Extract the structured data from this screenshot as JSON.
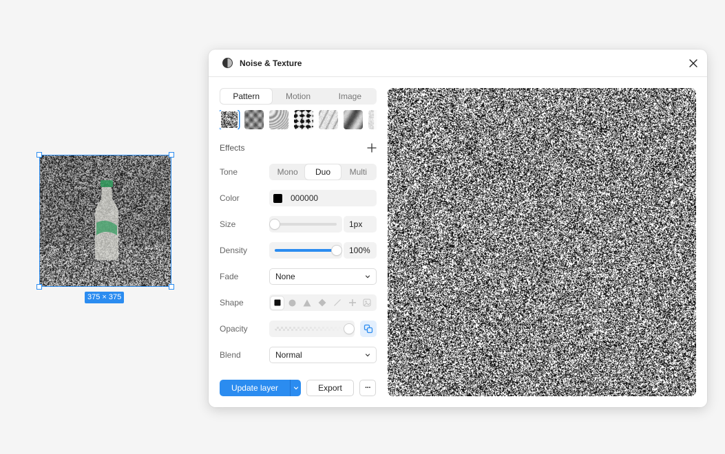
{
  "canvas": {
    "selection_size_label": "375 × 375"
  },
  "dialog": {
    "title": "Noise & Texture",
    "tabs": [
      {
        "label": "Pattern",
        "active": true
      },
      {
        "label": "Motion",
        "active": false
      },
      {
        "label": "Image",
        "active": false
      }
    ],
    "presets": [
      "fine-grain",
      "soft-blur",
      "swirl",
      "blotch",
      "speckle",
      "cloud",
      "partial"
    ],
    "effects_label": "Effects",
    "properties": {
      "tone": {
        "label": "Tone",
        "options": [
          "Mono",
          "Duo",
          "Multi"
        ],
        "selected": "Duo"
      },
      "color": {
        "label": "Color",
        "value": "000000",
        "swatch": "#000000"
      },
      "size": {
        "label": "Size",
        "value": "1px",
        "level": 0.0
      },
      "density": {
        "label": "Density",
        "value": "100%",
        "level": 1.0
      },
      "fade": {
        "label": "Fade",
        "value": "None"
      },
      "shape": {
        "label": "Shape",
        "options": [
          "square",
          "circle",
          "triangle",
          "diamond",
          "line",
          "plus",
          "image"
        ],
        "selected": "square"
      },
      "opacity": {
        "label": "Opacity",
        "level": 1.0
      },
      "blend": {
        "label": "Blend",
        "value": "Normal"
      }
    },
    "footer": {
      "update_label": "Update layer",
      "export_label": "Export",
      "more_label": "···"
    }
  },
  "colors": {
    "accent": "#2b8cf0",
    "panel_bg": "#ffffff",
    "page_bg": "#f5f5f5"
  }
}
